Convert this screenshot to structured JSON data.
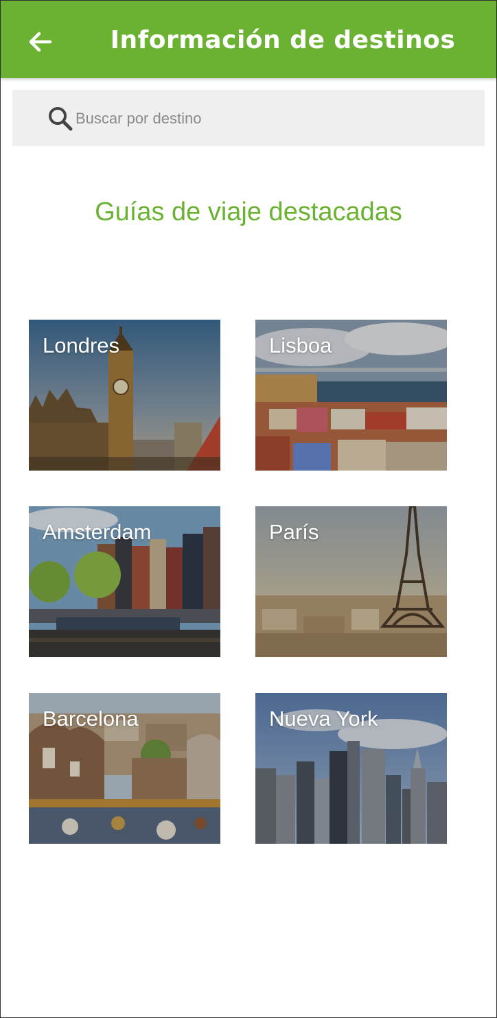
{
  "header": {
    "title": "Información de destinos",
    "back_icon": "arrow-left-icon",
    "color": "#6bb233"
  },
  "search": {
    "placeholder": "Buscar por destino",
    "value": "",
    "icon": "search-icon"
  },
  "featured": {
    "title": "Guías de viaje destacadas",
    "accent_color": "#6bb233",
    "cities": [
      {
        "name": "Londres"
      },
      {
        "name": "Lisboa"
      },
      {
        "name": "Amsterdam"
      },
      {
        "name": "París"
      },
      {
        "name": "Barcelona"
      },
      {
        "name": "Nueva York"
      }
    ]
  }
}
